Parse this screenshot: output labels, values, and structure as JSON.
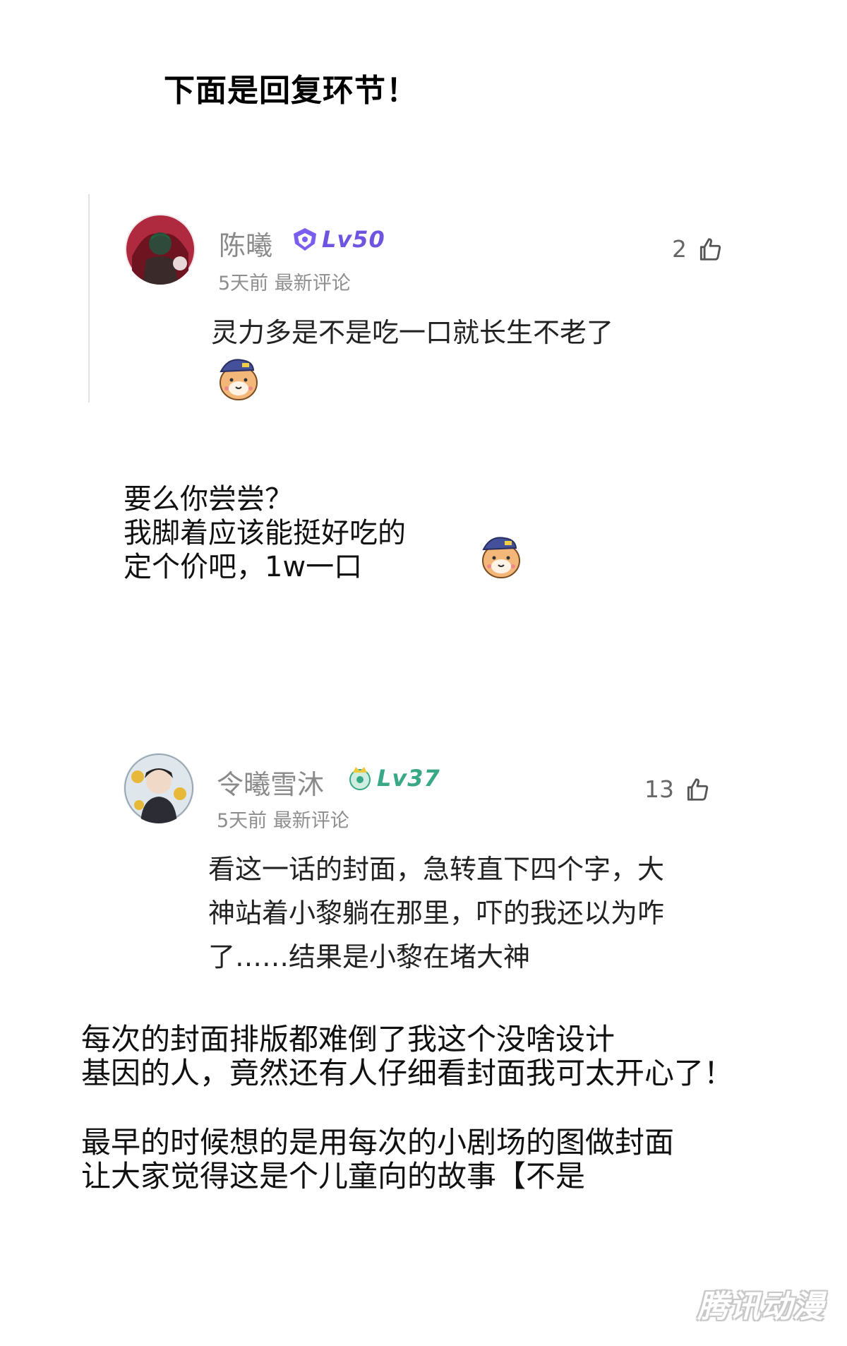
{
  "heading": "下面是回复环节！",
  "comments": [
    {
      "username": "陈曦",
      "level": "Lv50",
      "time": "5天前",
      "tag": "最新评论",
      "likes": "2",
      "text": "灵力多是不是吃一口就长生不老了",
      "colors": {
        "level": "#6f54e0"
      }
    },
    {
      "username": "令曦雪沐",
      "level": "Lv37",
      "time": "5天前",
      "tag": "最新评论",
      "likes": "13",
      "text_lines": [
        "看这一话的封面，急转直下四个字，大",
        "神站着小黎躺在那里，吓的我还以为咋",
        "了……结果是小黎在堵大神"
      ],
      "colors": {
        "level": "#39a887"
      }
    }
  ],
  "reply_1": [
    "要么你尝尝？",
    "我脚着应该能挺好吃的",
    "定个价吧，1w一口"
  ],
  "reply_2": {
    "paragraph_1": [
      "每次的封面排版都难倒了我这个没啥设计",
      "基因的人，竟然还有人仔细看封面我可太开心了！"
    ],
    "paragraph_2": [
      "最早的时候想的是用每次的小剧场的图做封面",
      "让大家觉得这是个儿童向的故事【不是"
    ]
  },
  "watermark": "腾讯动漫"
}
